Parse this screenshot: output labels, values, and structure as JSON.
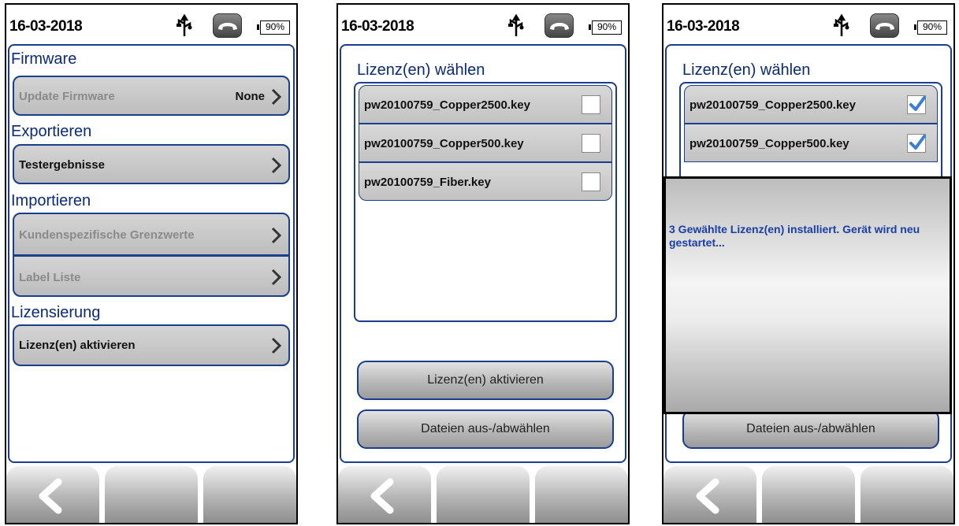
{
  "status": {
    "date": "16-03-2018",
    "battery": "90%"
  },
  "screen1": {
    "sections": {
      "firmware": "Firmware",
      "export": "Exportieren",
      "import": "Importieren",
      "license": "Lizensierung"
    },
    "update_firmware": {
      "label": "Update Firmware",
      "value": "None"
    },
    "test_results": "Testergebnisse",
    "custom_limits": "Kundenspezifische Grenzwerte",
    "label_list": "Label Liste",
    "activate_licenses": "Lizenz(en) aktivieren"
  },
  "screen2": {
    "title": "Lizenz(en) wählen",
    "items": [
      {
        "label": "pw20100759_Copper2500.key",
        "checked": false
      },
      {
        "label": "pw20100759_Copper500.key",
        "checked": false
      },
      {
        "label": "pw20100759_Fiber.key",
        "checked": false
      }
    ],
    "activate_button": "Lizenz(en) aktivieren",
    "toggle_button": "Dateien aus-/abwählen"
  },
  "screen3": {
    "title": "Lizenz(en) wählen",
    "items": [
      {
        "label": "pw20100759_Copper2500.key",
        "checked": true
      },
      {
        "label": "pw20100759_Copper500.key",
        "checked": true
      }
    ],
    "dialog_message": "3 Gewählte Lizenz(en) installiert. Gerät wird neu gestartet...",
    "toggle_button": "Dateien aus-/abwählen"
  },
  "icons": {
    "usb": "usb-icon",
    "phone": "phone-hangup-icon",
    "back": "back-chevron-icon",
    "check": "checkmark-icon"
  },
  "colors": {
    "accent": "#1a3e8c",
    "title_text": "#0a2a7a",
    "dialog_text": "#1a3ea8",
    "checkmark": "#3a7fd0"
  }
}
